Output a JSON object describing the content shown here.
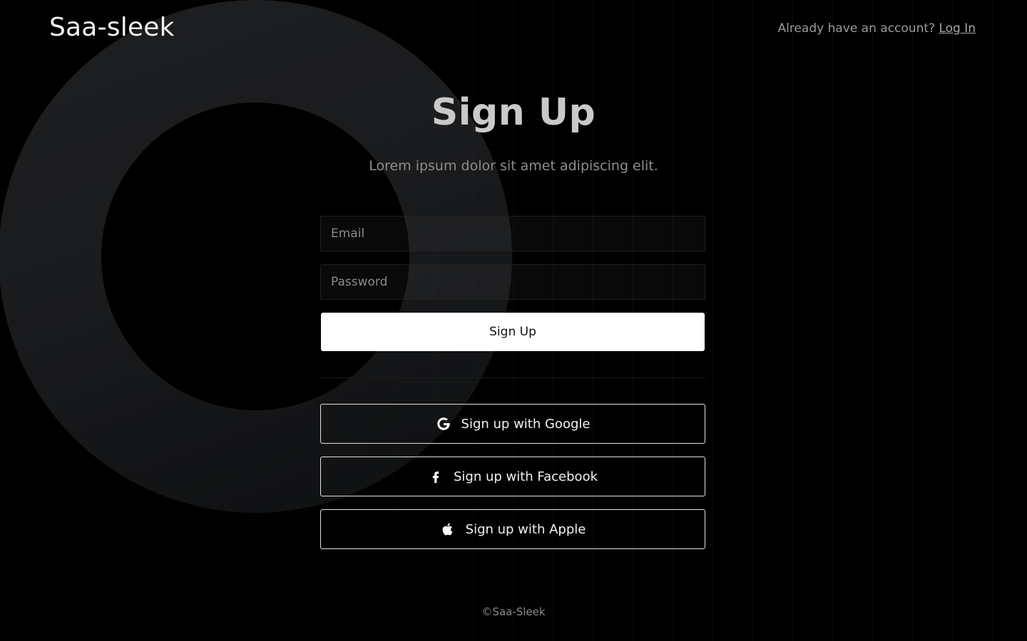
{
  "brand": {
    "logo_text": "Saa-sleek"
  },
  "header": {
    "prompt_text": "Already have an account?",
    "login_link": "Log In"
  },
  "main": {
    "title": "Sign Up",
    "subtitle": "Lorem ipsum dolor sit amet adipiscing elit."
  },
  "form": {
    "email_placeholder": "Email",
    "email_value": "",
    "password_placeholder": "Password",
    "password_value": "",
    "submit_label": "Sign Up"
  },
  "social": {
    "google_label": "Sign up with Google",
    "facebook_label": "Sign up with Facebook",
    "apple_label": "Sign up with Apple",
    "icons": [
      "google-icon",
      "facebook-icon",
      "apple-icon"
    ]
  },
  "footer": {
    "copyright": "©Saa-Sleek"
  },
  "colors": {
    "background": "#000000",
    "primary_button": "#ffffff",
    "text_muted": "#8e8e8e"
  }
}
